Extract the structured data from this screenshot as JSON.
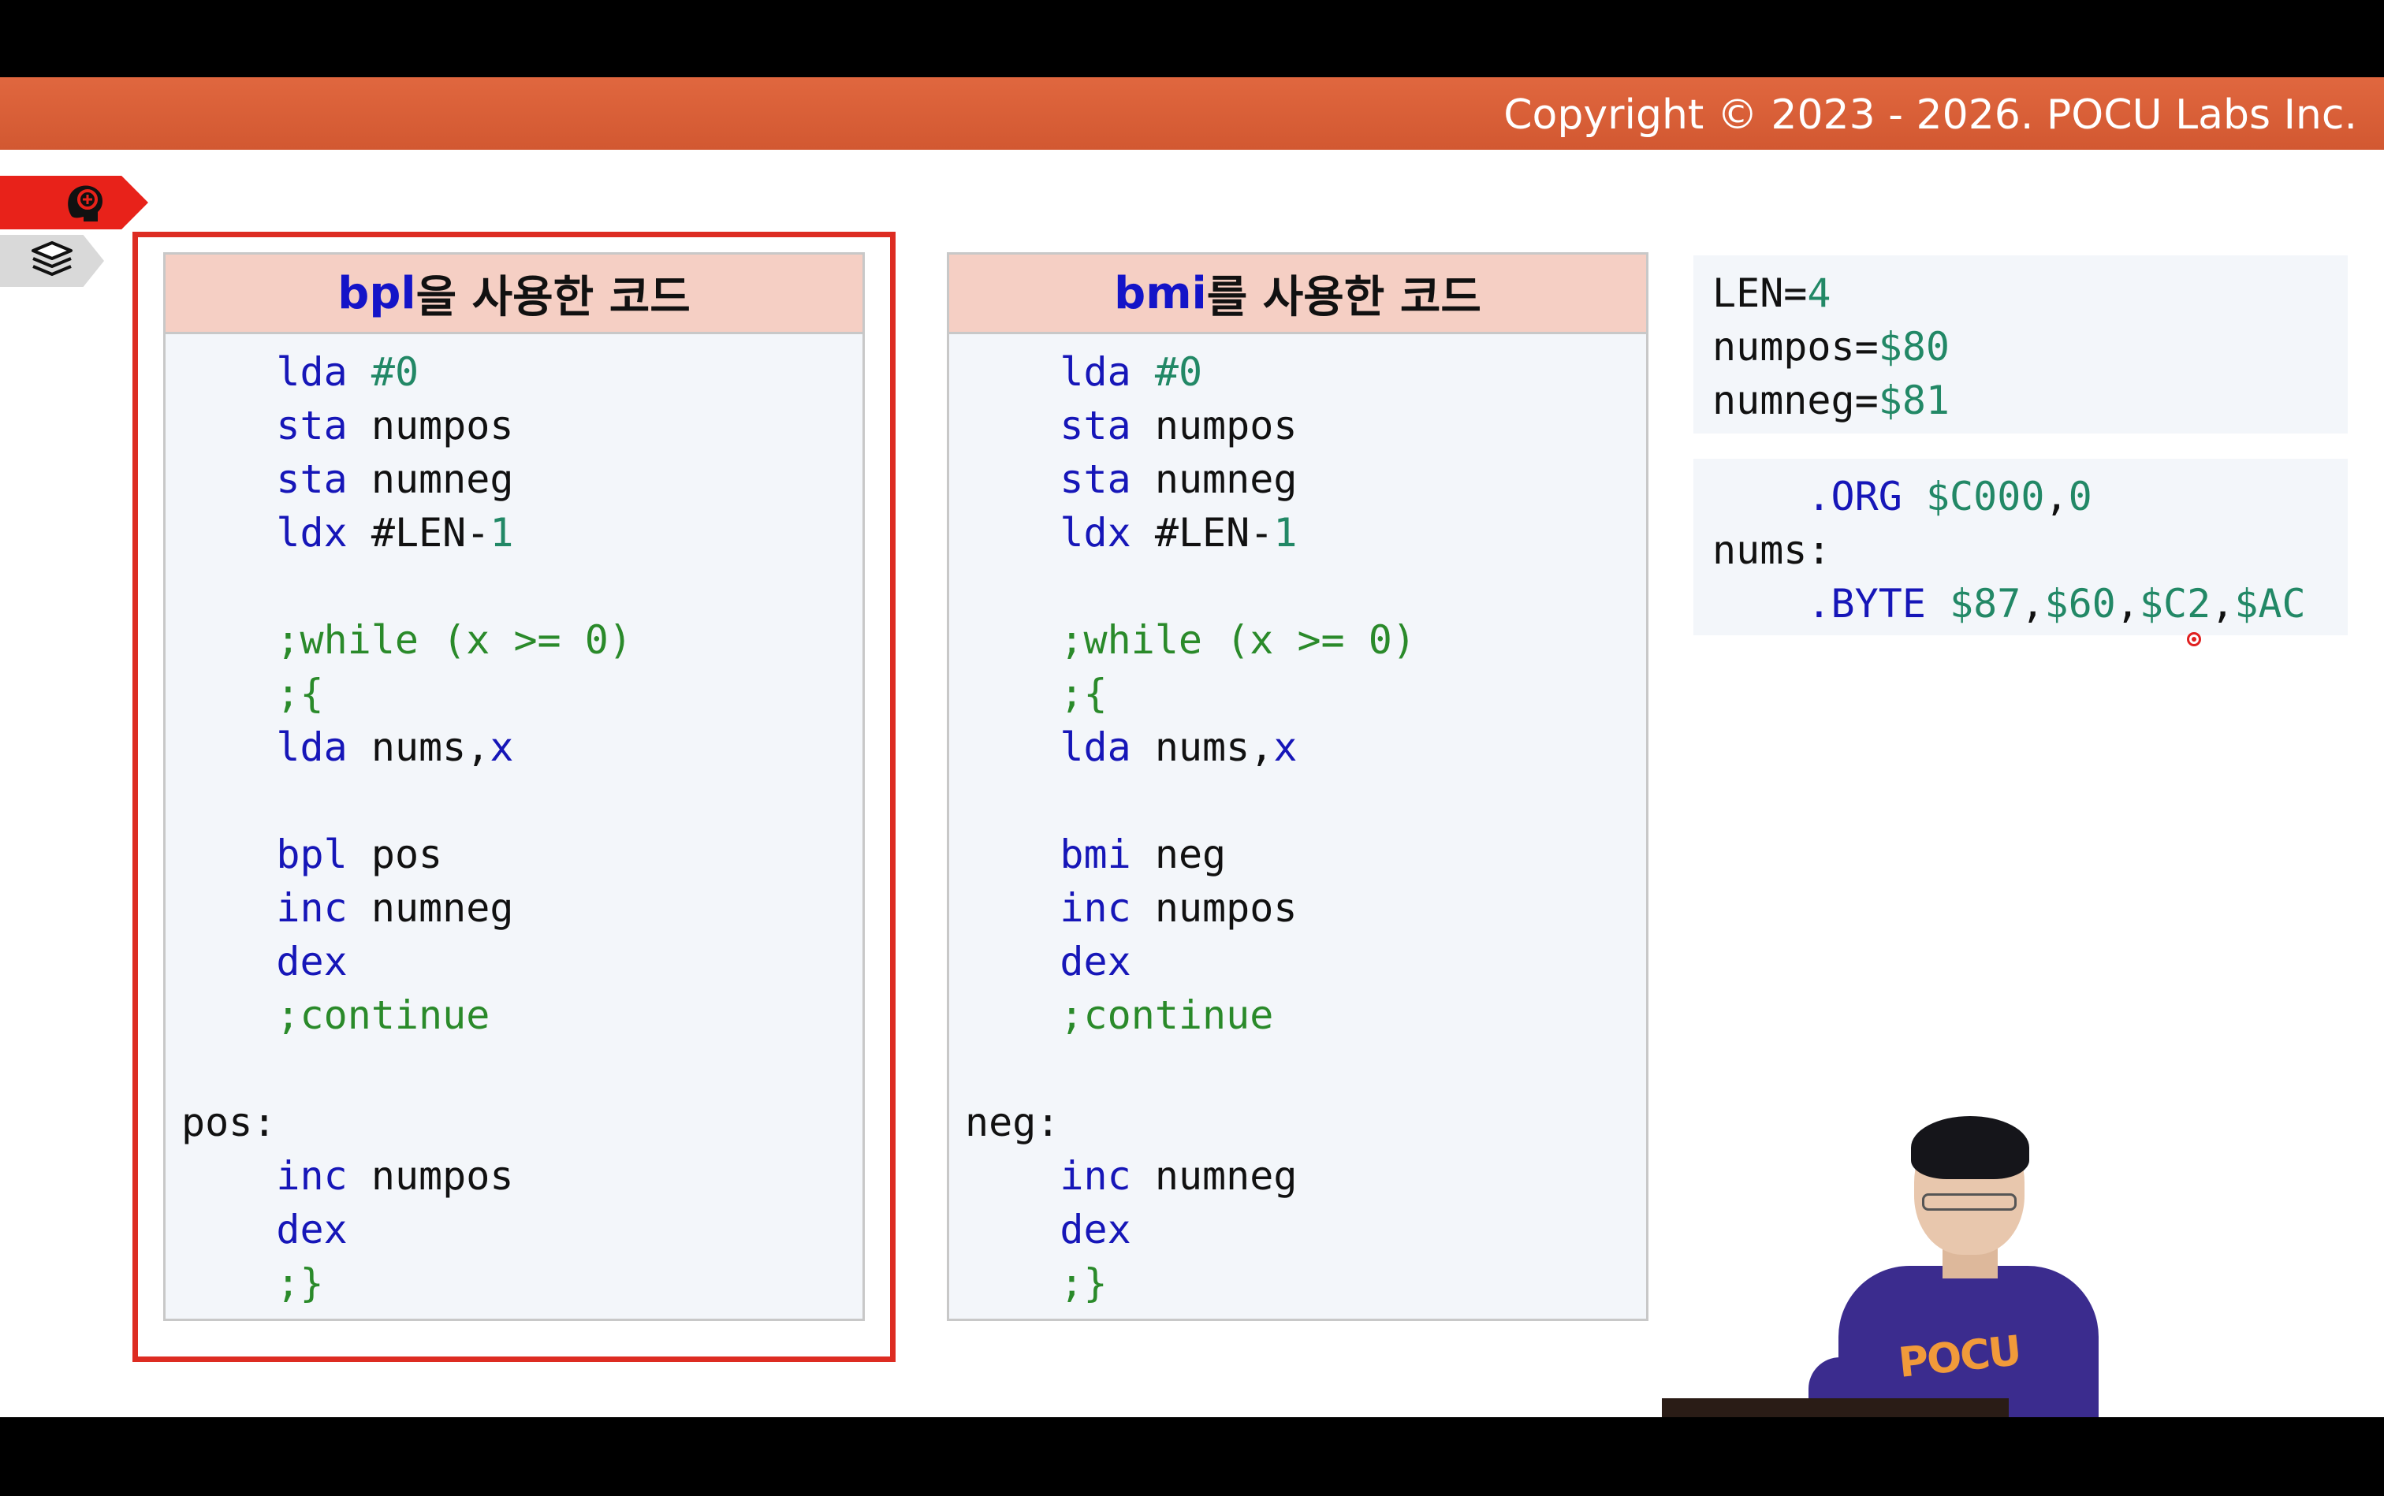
{
  "header": {
    "copyright": "Copyright © 2023 - 2026. POCU Labs Inc."
  },
  "side_tabs": [
    {
      "icon": "brain-head-icon",
      "color": "#e8221a"
    },
    {
      "icon": "book-stack-icon",
      "color": "#d9d9d9"
    }
  ],
  "left_panel": {
    "title_keyword": "bpl",
    "title_rest": "을 사용한 코드",
    "lines": [
      [
        {
          "t": "    "
        },
        {
          "t": "lda",
          "c": "kw"
        },
        {
          "t": " "
        },
        {
          "t": "#0",
          "c": "num"
        }
      ],
      [
        {
          "t": "    "
        },
        {
          "t": "sta",
          "c": "kw"
        },
        {
          "t": " numpos"
        }
      ],
      [
        {
          "t": "    "
        },
        {
          "t": "sta",
          "c": "kw"
        },
        {
          "t": " numneg"
        }
      ],
      [
        {
          "t": "    "
        },
        {
          "t": "ldx",
          "c": "kw"
        },
        {
          "t": " #LEN-"
        },
        {
          "t": "1",
          "c": "num"
        }
      ],
      [],
      [
        {
          "t": "    "
        },
        {
          "t": ";while (x >= 0)",
          "c": "cmt"
        }
      ],
      [
        {
          "t": "    "
        },
        {
          "t": ";{",
          "c": "cmt"
        }
      ],
      [
        {
          "t": "    "
        },
        {
          "t": "lda",
          "c": "kw"
        },
        {
          "t": " nums,"
        },
        {
          "t": "x",
          "c": "kw"
        }
      ],
      [],
      [
        {
          "t": "    "
        },
        {
          "t": "bpl",
          "c": "kw"
        },
        {
          "t": " pos"
        }
      ],
      [
        {
          "t": "    "
        },
        {
          "t": "inc",
          "c": "kw"
        },
        {
          "t": " numneg"
        }
      ],
      [
        {
          "t": "    "
        },
        {
          "t": "dex",
          "c": "kw"
        }
      ],
      [
        {
          "t": "    "
        },
        {
          "t": ";continue",
          "c": "cmt"
        }
      ],
      [],
      [
        {
          "t": "pos:"
        }
      ],
      [
        {
          "t": "    "
        },
        {
          "t": "inc",
          "c": "kw"
        },
        {
          "t": " numpos"
        }
      ],
      [
        {
          "t": "    "
        },
        {
          "t": "dex",
          "c": "kw"
        }
      ],
      [
        {
          "t": "    "
        },
        {
          "t": ";}",
          "c": "cmt"
        }
      ]
    ]
  },
  "right_panel": {
    "title_keyword": "bmi",
    "title_rest": "를 사용한 코드",
    "lines": [
      [
        {
          "t": "    "
        },
        {
          "t": "lda",
          "c": "kw"
        },
        {
          "t": " "
        },
        {
          "t": "#0",
          "c": "num"
        }
      ],
      [
        {
          "t": "    "
        },
        {
          "t": "sta",
          "c": "kw"
        },
        {
          "t": " numpos"
        }
      ],
      [
        {
          "t": "    "
        },
        {
          "t": "sta",
          "c": "kw"
        },
        {
          "t": " numneg"
        }
      ],
      [
        {
          "t": "    "
        },
        {
          "t": "ldx",
          "c": "kw"
        },
        {
          "t": " #LEN-"
        },
        {
          "t": "1",
          "c": "num"
        }
      ],
      [],
      [
        {
          "t": "    "
        },
        {
          "t": ";while (x >= 0)",
          "c": "cmt"
        }
      ],
      [
        {
          "t": "    "
        },
        {
          "t": ";{",
          "c": "cmt"
        }
      ],
      [
        {
          "t": "    "
        },
        {
          "t": "lda",
          "c": "kw"
        },
        {
          "t": " nums,"
        },
        {
          "t": "x",
          "c": "kw"
        }
      ],
      [],
      [
        {
          "t": "    "
        },
        {
          "t": "bmi",
          "c": "kw"
        },
        {
          "t": " neg"
        }
      ],
      [
        {
          "t": "    "
        },
        {
          "t": "inc",
          "c": "kw"
        },
        {
          "t": " numpos"
        }
      ],
      [
        {
          "t": "    "
        },
        {
          "t": "dex",
          "c": "kw"
        }
      ],
      [
        {
          "t": "    "
        },
        {
          "t": ";continue",
          "c": "cmt"
        }
      ],
      [],
      [
        {
          "t": "neg:"
        }
      ],
      [
        {
          "t": "    "
        },
        {
          "t": "inc",
          "c": "kw"
        },
        {
          "t": " numneg"
        }
      ],
      [
        {
          "t": "    "
        },
        {
          "t": "dex",
          "c": "kw"
        }
      ],
      [
        {
          "t": "    "
        },
        {
          "t": ";}",
          "c": "cmt"
        }
      ]
    ]
  },
  "constants_box": {
    "lines": [
      [
        {
          "t": "LEN="
        },
        {
          "t": "4",
          "c": "num"
        }
      ],
      [
        {
          "t": "numpos="
        },
        {
          "t": "$80",
          "c": "num"
        }
      ],
      [
        {
          "t": "numneg="
        },
        {
          "t": "$81",
          "c": "num"
        }
      ]
    ]
  },
  "data_box": {
    "lines": [
      [
        {
          "t": "    "
        },
        {
          "t": ".ORG",
          "c": "kw"
        },
        {
          "t": " "
        },
        {
          "t": "$C000",
          "c": "num"
        },
        {
          "t": ","
        },
        {
          "t": "0",
          "c": "num"
        }
      ],
      [
        {
          "t": "nums:"
        }
      ],
      [
        {
          "t": "    "
        },
        {
          "t": ".BYTE",
          "c": "kw"
        },
        {
          "t": " "
        },
        {
          "t": "$87",
          "c": "num"
        },
        {
          "t": ","
        },
        {
          "t": "$60",
          "c": "num"
        },
        {
          "t": ","
        },
        {
          "t": "$C2",
          "c": "num"
        },
        {
          "t": ","
        },
        {
          "t": "$AC",
          "c": "num"
        }
      ]
    ]
  },
  "presenter": {
    "shirt_text": "POCU"
  },
  "colors": {
    "accent_bar": "#d85c35",
    "highlight_frame": "#dd2c22",
    "header_fill": "#f5cfc4",
    "keyword": "#1616b8",
    "number": "#228866",
    "comment": "#2a8a2a"
  }
}
